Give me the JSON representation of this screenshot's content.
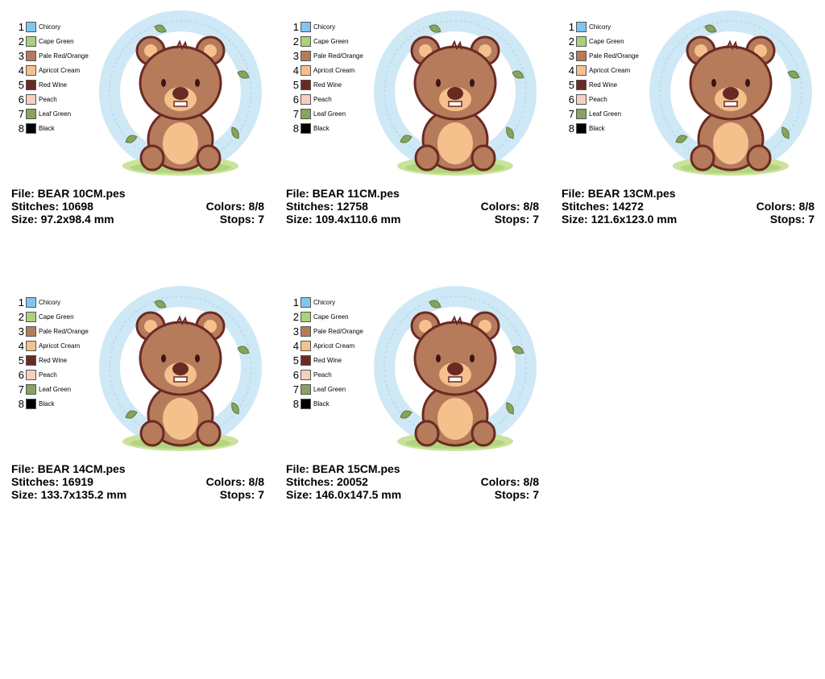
{
  "palette": [
    {
      "num": "1",
      "name": "Chicory",
      "color": "#7ec7ef"
    },
    {
      "num": "2",
      "name": "Cape Green",
      "color": "#a9d27a"
    },
    {
      "num": "3",
      "name": "Pale Red/Orange",
      "color": "#b57b5b"
    },
    {
      "num": "4",
      "name": "Apricot Cream",
      "color": "#f4c08c"
    },
    {
      "num": "5",
      "name": "Red Wine",
      "color": "#6a2a24"
    },
    {
      "num": "6",
      "name": "Peach",
      "color": "#f7cfc0"
    },
    {
      "num": "7",
      "name": "Leaf Green",
      "color": "#88a35c"
    },
    {
      "num": "8",
      "name": "Black",
      "color": "#000000"
    }
  ],
  "designs": [
    {
      "file": "File: BEAR 10CM.pes",
      "stitches": "Stitches: 10698",
      "colors": "Colors: 8/8",
      "size": "Size: 97.2x98.4 mm",
      "stops": "Stops: 7"
    },
    {
      "file": "File: BEAR 11CM.pes",
      "stitches": "Stitches: 12758",
      "colors": "Colors: 8/8",
      "size": "Size: 109.4x110.6 mm",
      "stops": "Stops: 7"
    },
    {
      "file": "File: BEAR 13CM.pes",
      "stitches": "Stitches: 14272",
      "colors": "Colors: 8/8",
      "size": "Size: 121.6x123.0 mm",
      "stops": "Stops: 7"
    },
    {
      "file": "File: BEAR 14CM.pes",
      "stitches": "Stitches: 16919",
      "colors": "Colors: 8/8",
      "size": "Size: 133.7x135.2 mm",
      "stops": "Stops: 7"
    },
    {
      "file": "File: BEAR 15CM.pes",
      "stitches": "Stitches: 20052",
      "colors": "Colors: 8/8",
      "size": "Size: 146.0x147.5 mm",
      "stops": "Stops: 7"
    }
  ]
}
